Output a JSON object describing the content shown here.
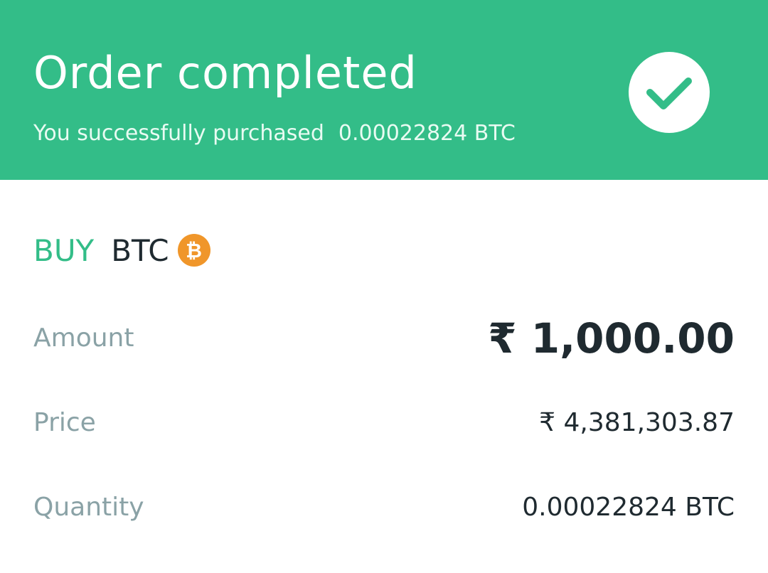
{
  "banner": {
    "title": "Order completed",
    "message_prefix": "You successfully purchased",
    "message_quantity": "0.00022824 BTC",
    "icon": "check-icon",
    "color": "#33bd88"
  },
  "order": {
    "side": "BUY",
    "asset": "BTC",
    "asset_icon": "bitcoin-icon",
    "asset_icon_glyph": "₿",
    "asset_icon_color": "#f0962a"
  },
  "details": {
    "amount": {
      "label": "Amount",
      "value": "₹ 1,000.00"
    },
    "price": {
      "label": "Price",
      "value": "₹ 4,381,303.87"
    },
    "quantity": {
      "label": "Quantity",
      "value": "0.00022824 BTC"
    }
  }
}
